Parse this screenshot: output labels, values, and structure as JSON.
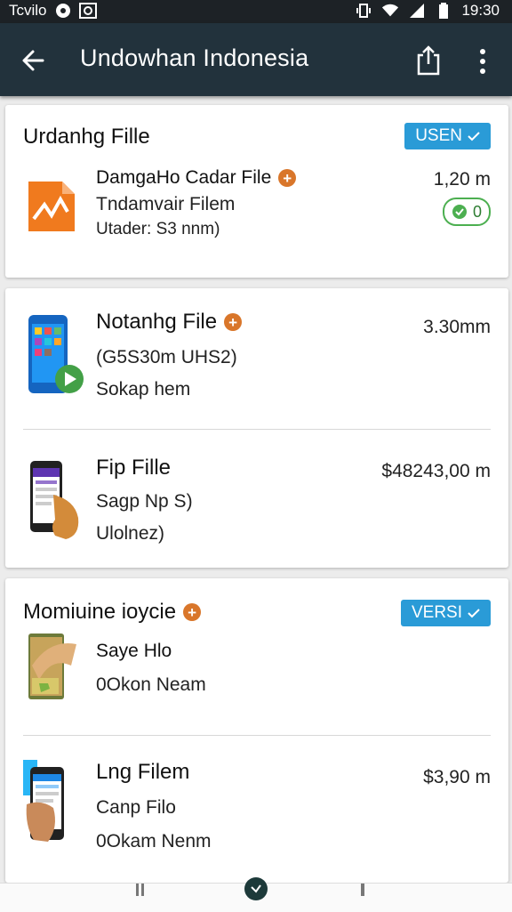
{
  "status_bar": {
    "left_text": "Tcvilo",
    "time": "19:30",
    "icons": [
      "notification-icon",
      "image-icon",
      "vibrate-icon",
      "wifi-icon",
      "signal-icon",
      "battery-icon"
    ]
  },
  "app_bar": {
    "title": "Undowhan Indonesia",
    "icons": [
      "back-arrow-icon",
      "share-icon",
      "more-vert-icon"
    ]
  },
  "cards": {
    "card1": {
      "title": "Urdanhg Fille",
      "badge": "USEN",
      "item": {
        "title": "DamgaHo Cadar File",
        "line2": "Tndamvair Filem",
        "line3": "Utader: S3 nnm)",
        "price": "1,20 m",
        "pill": "0"
      }
    },
    "card2": {
      "items": [
        {
          "title": "Notanhg File",
          "line2": "(G5S30m UHS2)",
          "line3": "Sokap hem",
          "price": "3.30mm"
        },
        {
          "title": "Fip Fille",
          "line2": "Sagp Np S)",
          "line3": "Ulolnez)",
          "price": "$48243,00 m"
        }
      ]
    },
    "card3": {
      "title": "Momiuine ioycie",
      "badge": "VERSI",
      "items": [
        {
          "title": "Saye Hlo",
          "line2": "0Okon Neam"
        },
        {
          "title": "Lng Filem",
          "line2": "Canp Filo",
          "line3": "0Okam Nenm",
          "price": "$3,90 m"
        }
      ]
    }
  },
  "colors": {
    "app_bar": "#22323c",
    "status_bar": "#1d2226",
    "badge": "#2a9bd7",
    "plus": "#d9762a",
    "pill": "#4caf50"
  }
}
